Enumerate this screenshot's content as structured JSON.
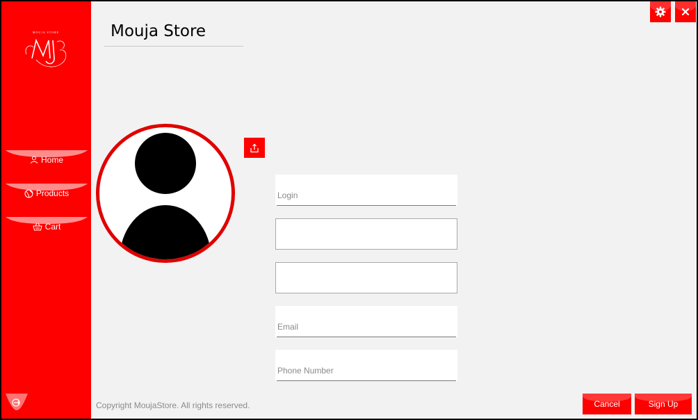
{
  "app": {
    "title": "Mouja Store",
    "brand_tagline": "MOUJA STORE",
    "brand_monogram": "MJ"
  },
  "colors": {
    "accent": "#ff0000",
    "avatar_ring": "#e00000",
    "background": "#f2f2f2"
  },
  "window_controls": {
    "settings_icon": "gear-icon",
    "close_icon": "close-icon"
  },
  "sidebar": {
    "items": [
      {
        "label": "Home",
        "icon": "user-icon"
      },
      {
        "label": "Products",
        "icon": "globe-icon"
      },
      {
        "label": "Cart",
        "icon": "basket-icon"
      }
    ],
    "logout_icon": "logout-icon"
  },
  "profile": {
    "avatar_icon": "default-user-avatar",
    "upload_icon": "upload-icon"
  },
  "form": {
    "login": {
      "placeholder": "Login",
      "value": ""
    },
    "field2": {
      "placeholder": "",
      "value": ""
    },
    "field3": {
      "placeholder": "",
      "value": ""
    },
    "email": {
      "placeholder": "Email",
      "value": ""
    },
    "phone": {
      "placeholder": "Phone Number",
      "value": ""
    }
  },
  "footer": {
    "copyright": "Copyright MoujaStore. All rights reserved.",
    "cancel_label": "Cancel",
    "signup_label": "Sign Up"
  }
}
